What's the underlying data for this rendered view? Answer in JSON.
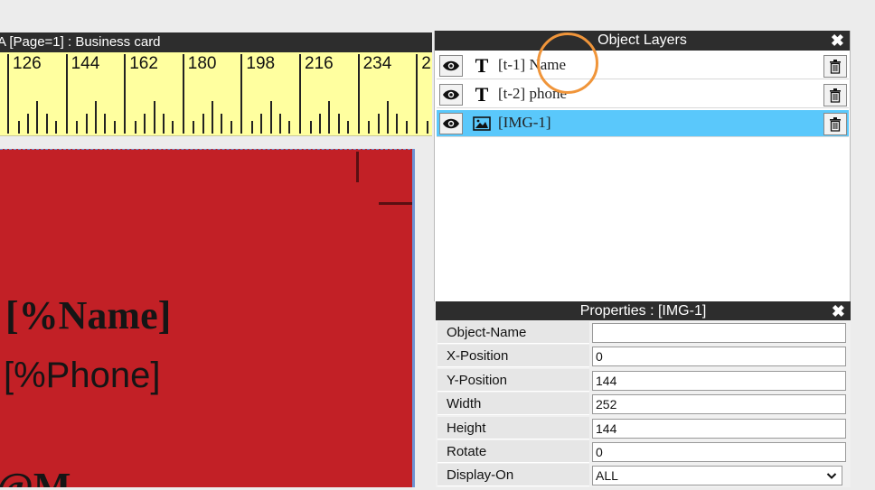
{
  "design_window": {
    "title": "A [Page=1] : Business card"
  },
  "ruler": {
    "labels": [
      "126",
      "144",
      "162",
      "180",
      "198",
      "216",
      "234",
      "2"
    ]
  },
  "card": {
    "name_placeholder": "[%Name]",
    "phone_placeholder": "[%Phone]",
    "logo_partial": "@M",
    "background_color": "#c22026"
  },
  "layers_panel": {
    "title": "Object Layers",
    "close_label": "✖",
    "layers": [
      {
        "label": "[t-1] Name",
        "type": "text",
        "type_glyph": "T",
        "icon": "text-icon",
        "selected": false
      },
      {
        "label": "[t-2] phone",
        "type": "text",
        "type_glyph": "T",
        "icon": "text-icon",
        "selected": false
      },
      {
        "label": "[IMG-1]",
        "type": "image",
        "type_glyph": "",
        "icon": "image-icon",
        "selected": true
      }
    ],
    "selected_color": "#5ac8fb"
  },
  "properties_panel": {
    "title": "Properties : [IMG-1]",
    "close_label": "✖",
    "rows": [
      {
        "label": "Object-Name",
        "value": ""
      },
      {
        "label": "X-Position",
        "value": "0"
      },
      {
        "label": "Y-Position",
        "value": "144"
      },
      {
        "label": "Width",
        "value": "252"
      },
      {
        "label": "Height",
        "value": "144"
      },
      {
        "label": "Rotate",
        "value": "0"
      },
      {
        "label": "Display-On",
        "value": "ALL",
        "kind": "select"
      }
    ]
  }
}
